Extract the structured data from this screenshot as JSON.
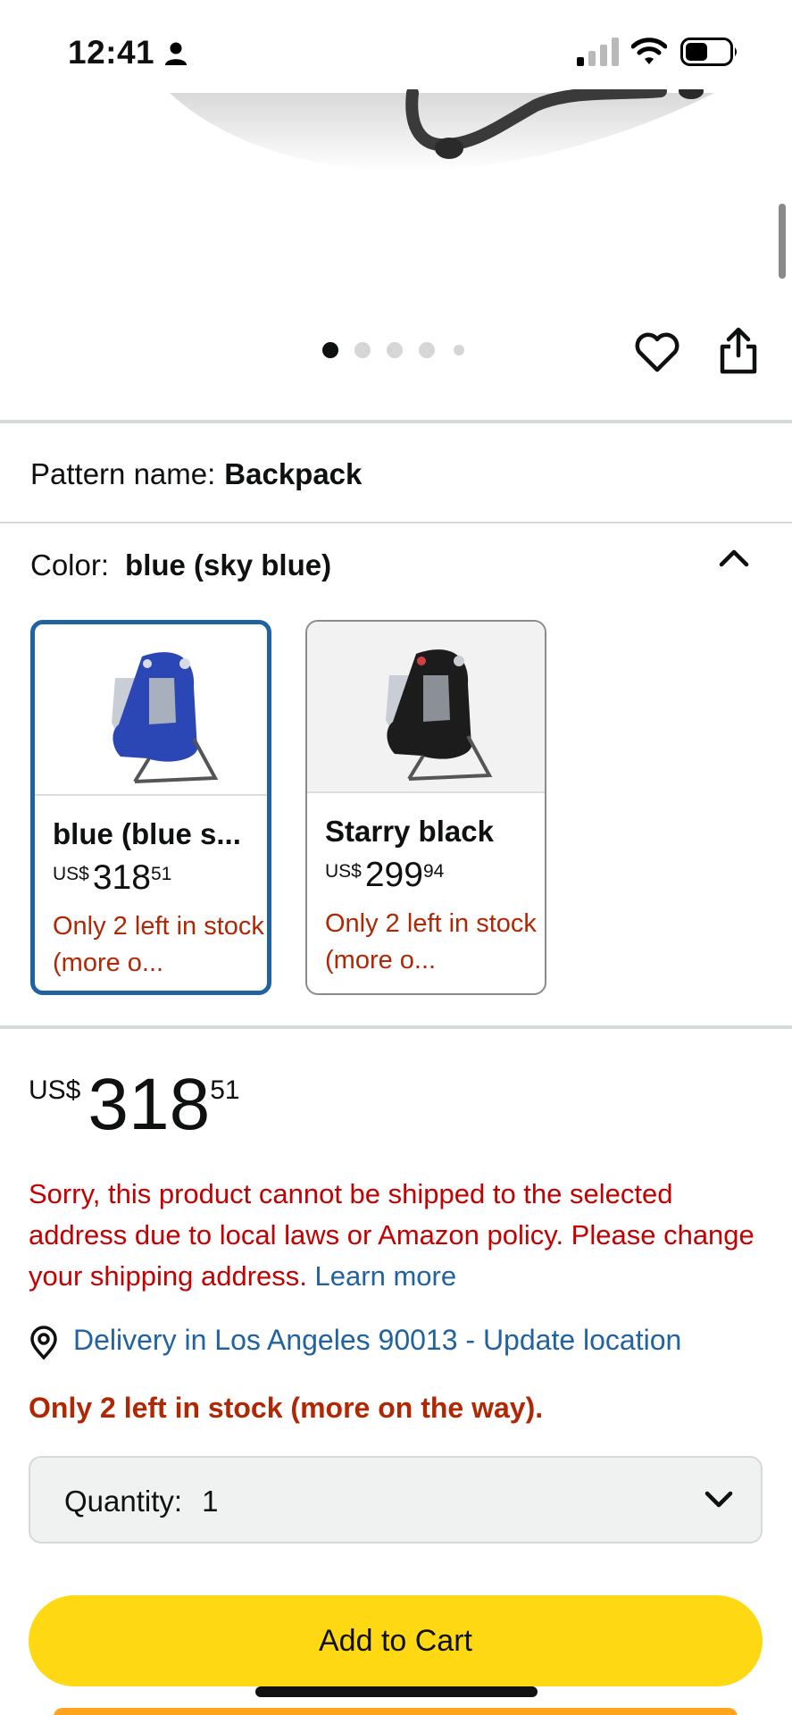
{
  "status_bar": {
    "time": "12:41"
  },
  "gallery": {
    "page_count": 5,
    "active_index": 0
  },
  "pattern": {
    "label": "Pattern name:",
    "value": "Backpack"
  },
  "color": {
    "label": "Color:",
    "value": "blue (sky blue)",
    "options": [
      {
        "name": "blue (blue s...",
        "currency": "US$",
        "whole": "318",
        "fraction": "51",
        "stock": "Only 2 left in stock (more o...",
        "selected": true,
        "product_color": "#2b47b5"
      },
      {
        "name": "Starry black",
        "currency": "US$",
        "whole": "299",
        "fraction": "94",
        "stock": "Only 2 left in stock (more o...",
        "selected": false,
        "product_color": "#1c1c1c"
      }
    ]
  },
  "price": {
    "currency": "US$",
    "whole": "318",
    "fraction": "51"
  },
  "shipping_error": {
    "message": "Sorry, this product cannot be shipped to the selected address due to local laws or Amazon policy. Please change your shipping address.",
    "link_label": "Learn more"
  },
  "delivery": {
    "link_label": "Delivery in Los Angeles 90013 - Update location"
  },
  "stock_status": "Only 2 left in stock (more on the way).",
  "quantity": {
    "label": "Quantity:",
    "value": "1"
  },
  "actions": {
    "add_to_cart_label": "Add to Cart"
  },
  "colors": {
    "selected_border": "#2162a1",
    "stock_red": "#b12704",
    "error_red": "#c40000",
    "link_blue": "#2162a1",
    "cart_yellow": "#ffd814",
    "buy_orange": "#ffa41c"
  },
  "icons": {
    "status": [
      "person-icon",
      "signal-icon",
      "wifi-icon",
      "battery-icon"
    ],
    "actions": [
      "heart-icon",
      "share-icon"
    ],
    "misc": [
      "chevron-up-icon",
      "location-pin-icon",
      "chevron-down-icon"
    ]
  }
}
